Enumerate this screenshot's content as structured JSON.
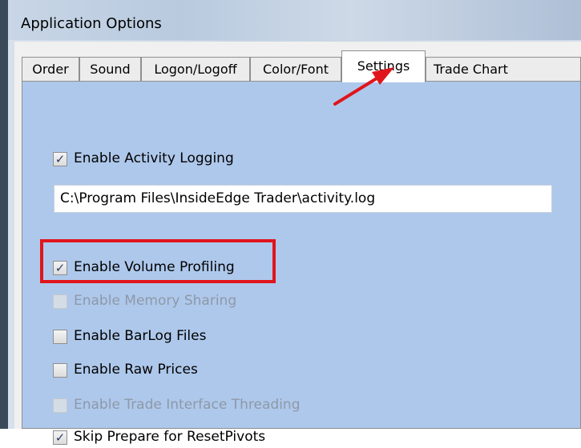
{
  "window": {
    "title": "Application Options"
  },
  "tabs": [
    {
      "label": "Order"
    },
    {
      "label": "Sound"
    },
    {
      "label": "Logon/Logoff"
    },
    {
      "label": "Color/Font"
    },
    {
      "label": "Settings",
      "active": true
    },
    {
      "label": "Trade Chart"
    }
  ],
  "settings": {
    "activity_logging": {
      "label": "Enable Activity Logging",
      "checked": true
    },
    "log_path": {
      "value": "C:\\Program Files\\InsideEdge Trader\\activity.log"
    },
    "volume_profiling": {
      "label": "Enable Volume Profiling",
      "checked": true,
      "highlighted": true
    },
    "memory_sharing": {
      "label": "Enable Memory Sharing",
      "checked": false,
      "disabled": true
    },
    "barlog_files": {
      "label": "Enable BarLog Files",
      "checked": false
    },
    "raw_prices": {
      "label": "Enable Raw Prices",
      "checked": false
    },
    "trade_threading": {
      "label": "Enable Trade Interface Threading",
      "checked": false,
      "disabled": true
    },
    "skip_prepare": {
      "label": "Skip Prepare for ResetPivots",
      "checked": true
    }
  },
  "annotation_colors": {
    "arrow": "#e0151c",
    "highlight_box": "#e0151c"
  },
  "glyphs": {
    "check": "✓"
  }
}
